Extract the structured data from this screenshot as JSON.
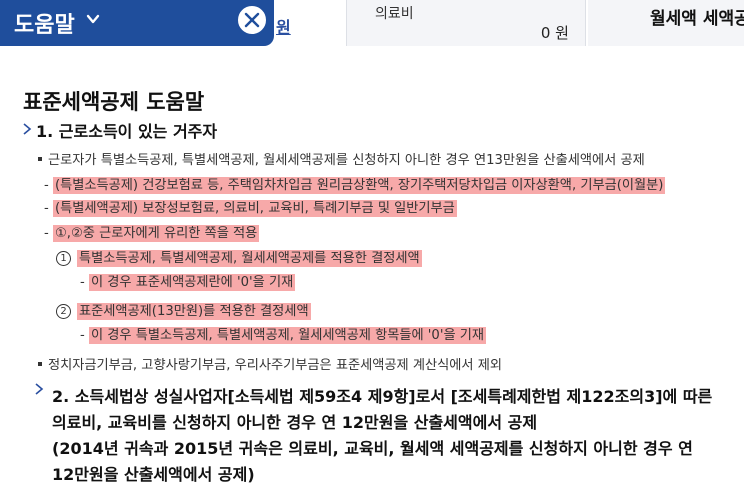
{
  "header": {
    "help_title": "도움말",
    "link_fragment": "원",
    "medical": {
      "label": "의료비",
      "value": "0 원"
    },
    "monthly_rent_title": "월세액 세액공제"
  },
  "page": {
    "title": "표준세액공제 도움말",
    "section1": {
      "title": "1. 근로소득이 있는 거주자",
      "bullet1": "근로자가 특별소득공제, 특별세액공제, 월세세액공제를 신청하지 아니한 경우 연13만원을 산출세액에서 공제",
      "sub1": "(특별소득공제) 건강보험료 등, 주택임차차입금 원리금상환액, 장기주택저당차입금 이자상환액, 기부금(이월분)",
      "sub2": "(특별세액공제) 보장성보험료, 의료비, 교육비, 특례기부금 및 일반기부금",
      "sub3": "①,②중 근로자에게 유리한 쪽을 적용",
      "opt1_num": "1",
      "opt1": "특별소득공제, 특별세액공제, 월세세액공제를 적용한 결정세액",
      "opt1_note": "이 경우 표준세액공제란에 '0'을 기재",
      "opt2_num": "2",
      "opt2": "표준세액공제(13만원)를 적용한 결정세액",
      "opt2_note": "이 경우 특별소득공제, 특별세액공제, 월세세액공제 항목들에 '0'을 기재",
      "bullet2": "정치자금기부금, 고향사랑기부금, 우리사주기부금은 표준세액공제 계산식에서 제외"
    },
    "section2": {
      "line1": "2. 소득세법상 성실사업자[소득세법 제59조4 제9항]로서 [조세특례제한법 제122조의3]에 따른",
      "line2": "의료비, 교육비를 신청하지 아니한 경우 연 12만원을 산출세액에서 공제",
      "line3": "(2014년 귀속과 2015년 귀속은 의료비, 교육비, 월세액 세액공제를 신청하지 아니한 경우 연",
      "line4": "12만원을 산출세액에서 공제)"
    }
  },
  "colors": {
    "header_blue": "#1f4e9c",
    "highlight": "#f7a9a9",
    "panel_gray": "#f4f5f8"
  },
  "icons": [
    "chevron-down-icon",
    "close-icon",
    "chevron-right-icon"
  ]
}
